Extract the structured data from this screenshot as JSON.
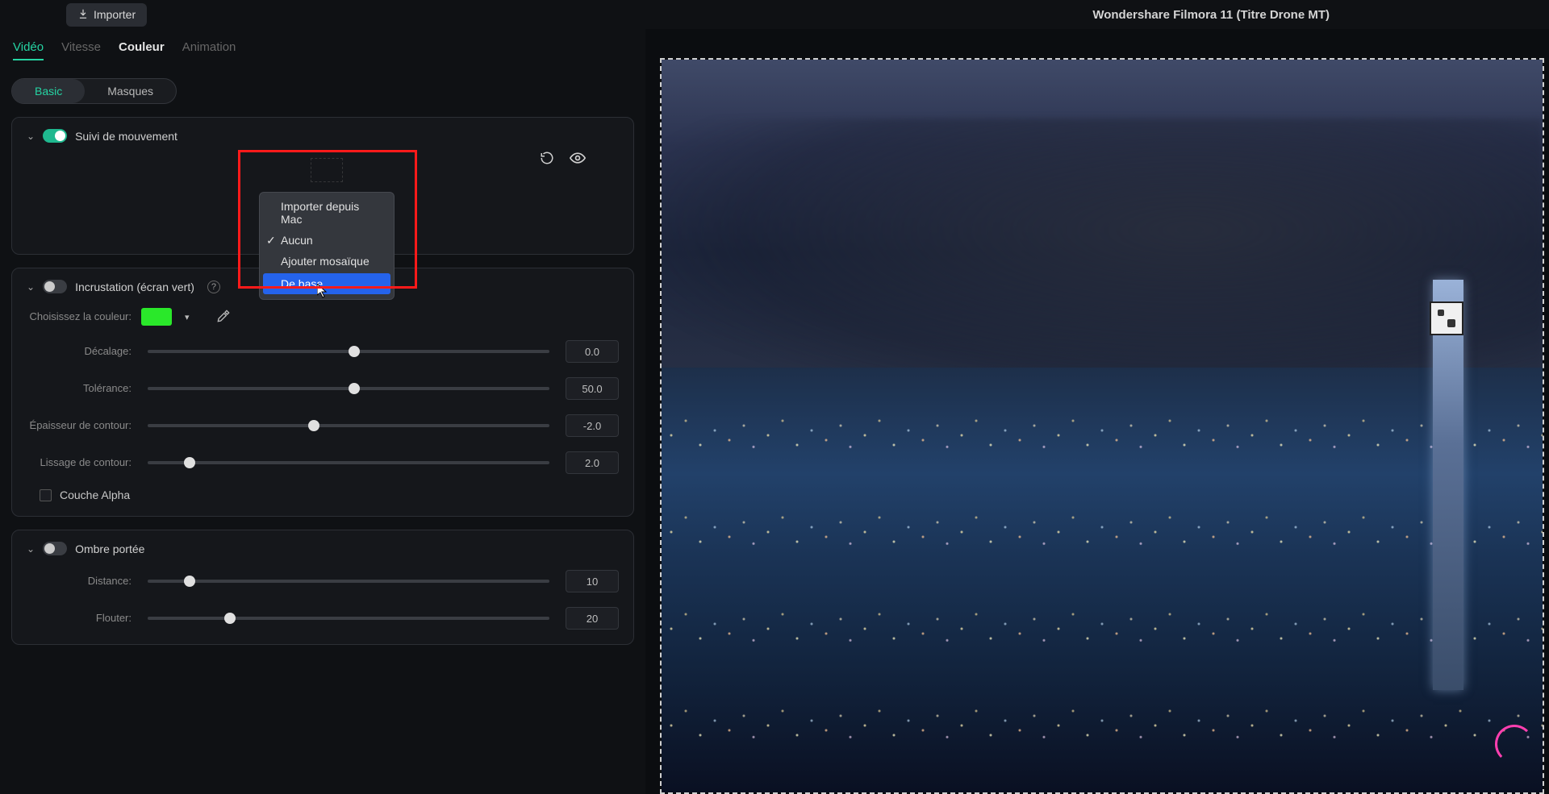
{
  "app": {
    "title": "Wondershare Filmora 11 (Titre Drone MT)",
    "import_button": "Importer"
  },
  "tabs": {
    "video": "Vidéo",
    "speed": "Vitesse",
    "color": "Couleur",
    "animation": "Animation"
  },
  "subtabs": {
    "basic": "Basic",
    "masks": "Masques"
  },
  "sections": {
    "motion_tracking": {
      "title": "Suivi de mouvement"
    },
    "chroma_key": {
      "title": "Incrustation (écran vert)"
    },
    "drop_shadow": {
      "title": "Ombre portée"
    }
  },
  "dropdown": {
    "items": [
      {
        "label": "Importer depuis Mac",
        "checked": false,
        "highlighted": false
      },
      {
        "label": "Aucun",
        "checked": true,
        "highlighted": false
      },
      {
        "label": "Ajouter mosaïque",
        "checked": false,
        "highlighted": false
      },
      {
        "label": "De base",
        "checked": false,
        "highlighted": true
      }
    ]
  },
  "chroma": {
    "choose_color_label": "Choisissez la couleur:",
    "color_hex": "#2ae82a",
    "offset": {
      "label": "Décalage:",
      "value": "0.0",
      "percent": 50
    },
    "tolerance": {
      "label": "Tolérance:",
      "value": "50.0",
      "percent": 50
    },
    "edge_thickness": {
      "label": "Épaisseur de contour:",
      "value": "-2.0",
      "percent": 40
    },
    "edge_feather": {
      "label": "Lissage de contour:",
      "value": "2.0",
      "percent": 9
    },
    "alpha_channel_label": "Couche Alpha"
  },
  "shadow": {
    "distance": {
      "label": "Distance:",
      "value": "10",
      "percent": 9
    },
    "blur": {
      "label": "Flouter:",
      "value": "20",
      "percent": 19
    }
  }
}
